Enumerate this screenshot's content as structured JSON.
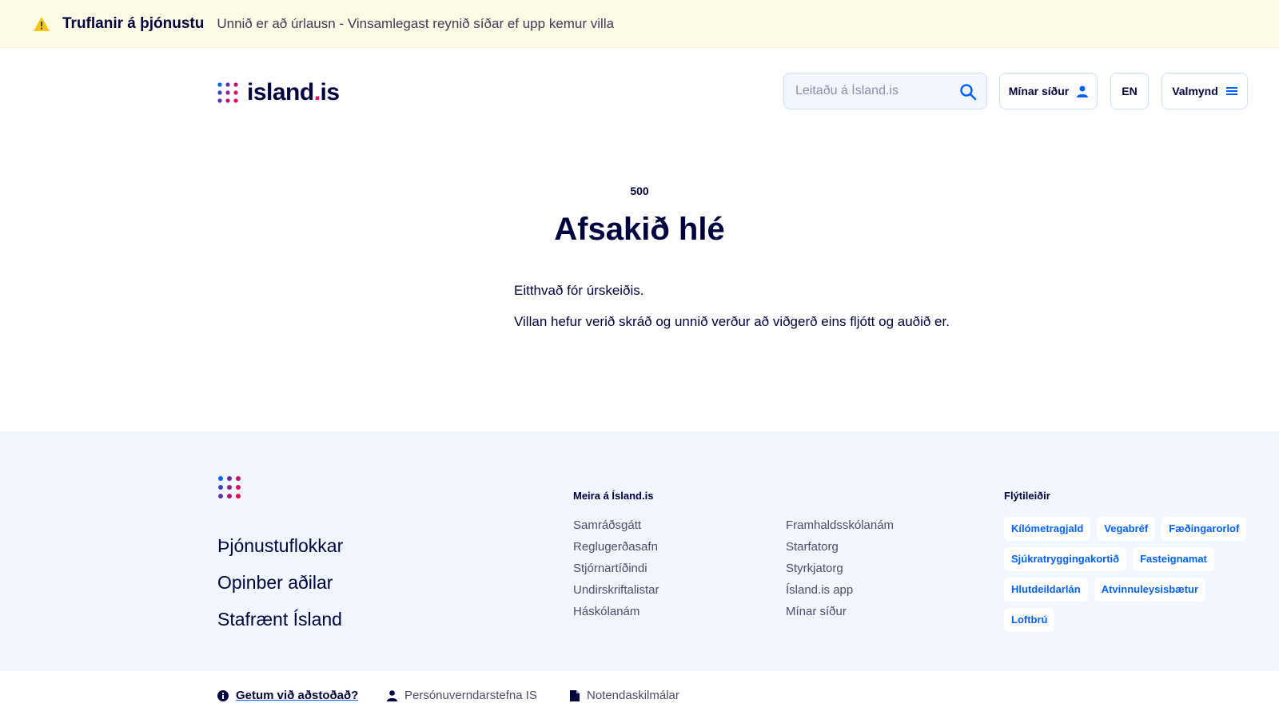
{
  "alert": {
    "title": "Truflanir á þjónustu",
    "message": "Unnið er að úrlausn - Vinsamlegast reynið síðar ef upp kemur villa",
    "icon": "warning-icon",
    "color": "#f5c518"
  },
  "header": {
    "logo_text_main": "island",
    "logo_text_dot": ".",
    "logo_text_tld": "is",
    "search_placeholder": "Leitaðu á Ísland.is",
    "my_pages_label": "Mínar síður",
    "lang_label": "EN",
    "menu_label": "Valmynd"
  },
  "main": {
    "error_code": "500",
    "title": "Afsakið hlé",
    "paragraph1": "Eitthvað fór úrskeiðis.",
    "paragraph2": "Villan hefur verið skráð og unnið verður að viðgerð eins fljótt og auðið er."
  },
  "footer": {
    "big_links": [
      "Þjónustuflokkar",
      "Opinber aðilar",
      "Stafrænt Ísland"
    ],
    "more_heading": "Meira á Ísland.is",
    "more_col_a": [
      "Samráðsgátt",
      "Reglugerðasafn",
      "Stjórnartíðindi",
      "Undirskriftalistar",
      "Háskólanám"
    ],
    "more_col_b": [
      "Framhaldsskólanám",
      "Starfatorg",
      "Styrkjatorg",
      "Ísland.is app",
      "Mínar síður"
    ],
    "quick_heading": "Flýtileiðir",
    "quick_tags": [
      "Kílómetragjald",
      "Vegabréf",
      "Fæðingarorlof",
      "Sjúkratryggingakortið",
      "Fasteignamat",
      "Hlutdeildarlán",
      "Atvinnuleysisbætur",
      "Loftbrú"
    ]
  },
  "bottombar": {
    "help_label": "Getum við aðstoðað?",
    "privacy_label": "Persónuverndarstefna IS",
    "terms_label": "Notendaskilmálar"
  },
  "colors": {
    "primary": "#0061ff",
    "dark": "#00003c",
    "footer_bg": "#f2f7ff",
    "alert_bg": "#fefbe6"
  }
}
